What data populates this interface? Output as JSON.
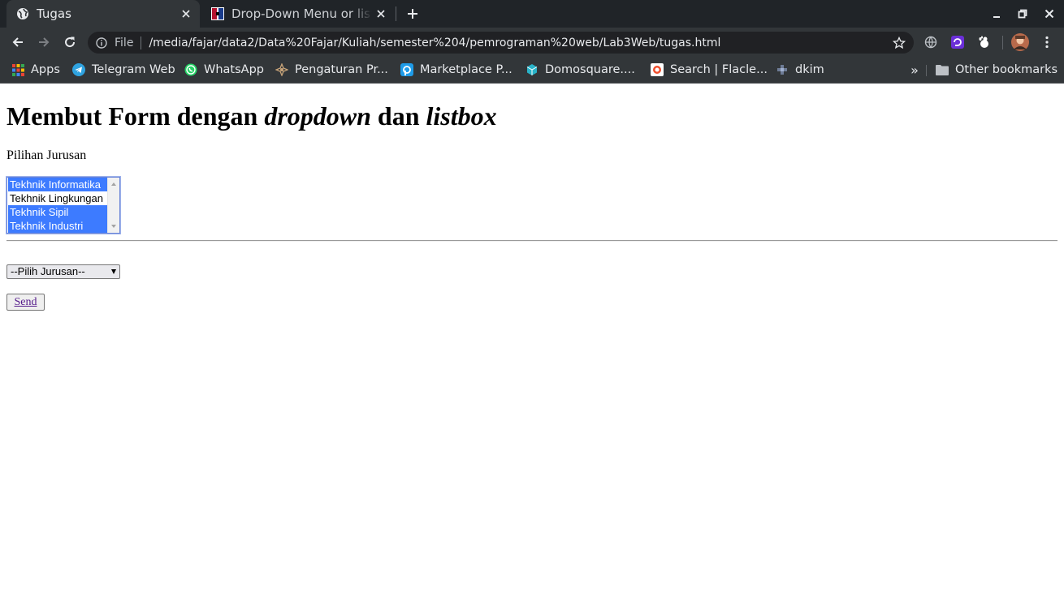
{
  "browser": {
    "tabs": [
      {
        "title": "Tugas",
        "icon": "globe-icon",
        "active": true
      },
      {
        "title": "Drop-Down Menu or list box",
        "icon": "site-favicon",
        "active": false
      }
    ],
    "address": {
      "scheme_label": "File",
      "url": "/media/fajar/data2/Data%20Fajar/Kuliah/semester%204/pemrograman%20web/Lab3Web/tugas.html"
    },
    "bookmarks": [
      {
        "label": "Apps",
        "icon": "apps-grid-icon"
      },
      {
        "label": "Telegram Web",
        "icon": "telegram-icon"
      },
      {
        "label": "WhatsApp",
        "icon": "whatsapp-icon"
      },
      {
        "label": "Pengaturan Pr...",
        "icon": "settings-favicon"
      },
      {
        "label": "Marketplace P...",
        "icon": "marketplace-icon"
      },
      {
        "label": "Domosquare....",
        "icon": "domosquare-icon"
      },
      {
        "label": "Search | Flacle...",
        "icon": "flacle-icon"
      },
      {
        "label": "dkim",
        "icon": "dkim-icon"
      }
    ],
    "more_bookmarks": "»",
    "other_bookmarks": "Other bookmarks",
    "colors": {
      "chrome_dark": "#202428",
      "chrome_tab": "#323639",
      "selected_option": "#3d7bff"
    }
  },
  "page": {
    "heading": {
      "part1": "Membut Form dengan ",
      "part2": "dropdown",
      "part3": " dan ",
      "part4": "listbox"
    },
    "label": "Pilihan Jurusan",
    "listbox_options": [
      {
        "text": "Tekhnik Informatika",
        "selected": true
      },
      {
        "text": "Tekhnik Lingkungan",
        "selected": false
      },
      {
        "text": "Tekhnik Sipil",
        "selected": true
      },
      {
        "text": "Tekhnik Industri",
        "selected": true
      }
    ],
    "dropdown_value": "--Pilih Jurusan--",
    "send_label": "Send"
  }
}
